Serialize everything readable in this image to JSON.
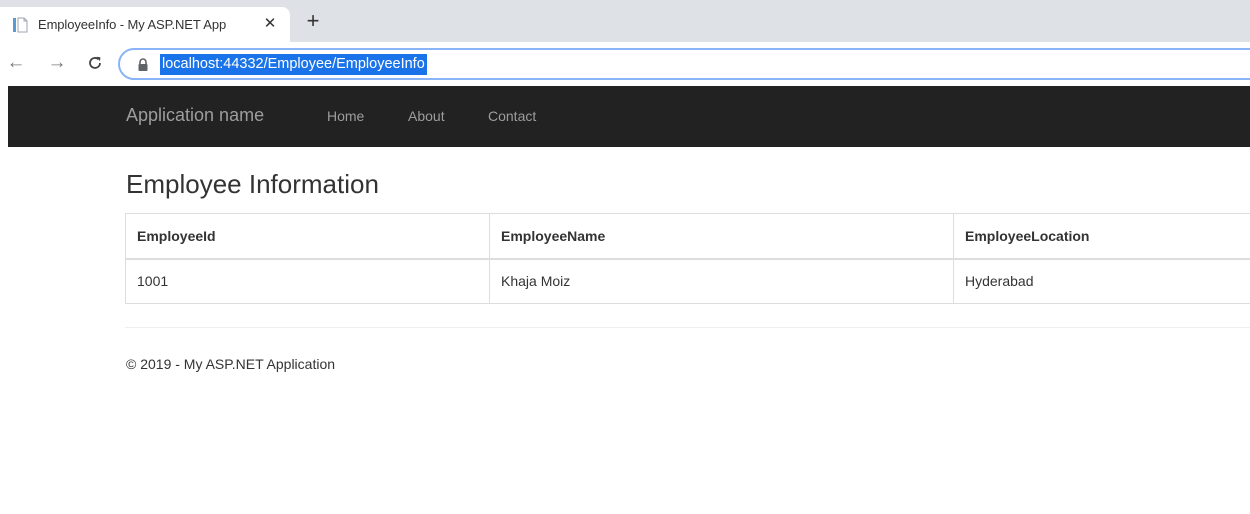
{
  "browser": {
    "tab": {
      "title": "EmployeeInfo - My ASP.NET App",
      "close_glyph": "✕",
      "favicon": "page-icon"
    },
    "new_tab_glyph": "+",
    "nav": {
      "back_glyph": "←",
      "forward_glyph": "→",
      "reload_glyph": "C"
    },
    "url": "localhost:44332/Employee/EmployeeInfo",
    "url_highlight_color": "#1a73e8"
  },
  "navbar": {
    "brand": "Application name",
    "links": [
      "Home",
      "About",
      "Contact"
    ],
    "background": "#222222",
    "link_color": "#9d9d9d"
  },
  "page": {
    "title": "Employee Information"
  },
  "table": {
    "headers": [
      "EmployeeId",
      "EmployeeName",
      "EmployeeLocation"
    ],
    "rows": [
      [
        "1001",
        "Khaja Moiz",
        "Hyderabad"
      ]
    ]
  },
  "footer": {
    "text": "© 2019 - My ASP.NET Application"
  }
}
